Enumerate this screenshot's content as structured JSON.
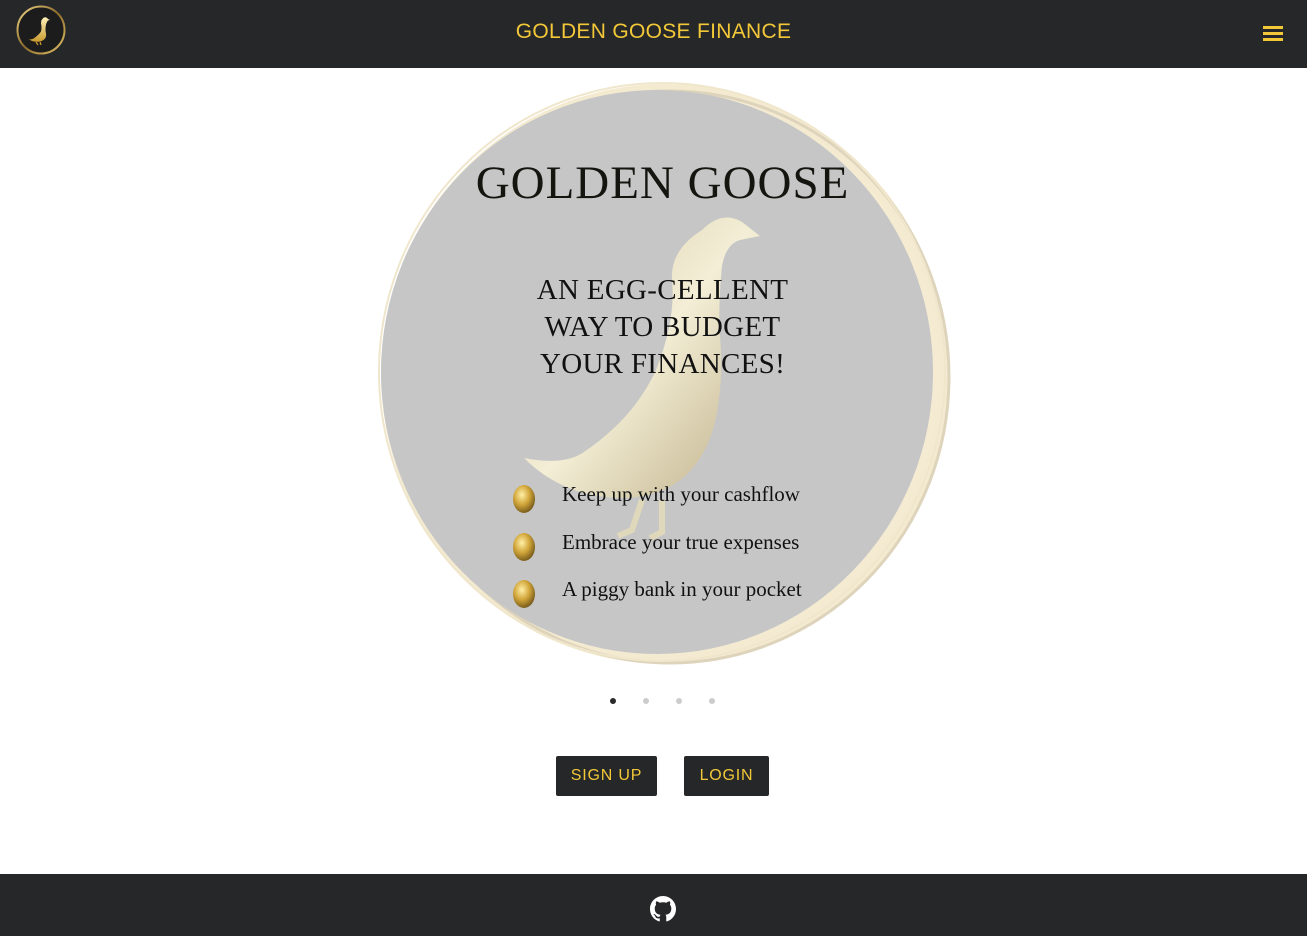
{
  "header": {
    "title": "GOLDEN GOOSE FINANCE",
    "logo_icon": "goose-logo-icon",
    "menu_icon": "hamburger-menu-icon"
  },
  "carousel": {
    "active_index": 0,
    "slide_count": 4,
    "slide": {
      "heading": "GOLDEN GOOSE",
      "tagline": [
        "AN EGG-CELLENT",
        "WAY TO BUDGET",
        "YOUR FINANCES!"
      ],
      "features": [
        "Keep up with your cashflow",
        "Embrace your true expenses",
        "A piggy bank in your pocket"
      ]
    }
  },
  "actions": {
    "signup_label": "SIGN UP",
    "login_label": "LOGIN"
  },
  "footer": {
    "github_icon": "github-icon"
  },
  "colors": {
    "bar_bg": "#262729",
    "accent_gold": "#f2c838",
    "dot_active": "#2a2a2a",
    "dot_inactive": "#cccccc"
  }
}
